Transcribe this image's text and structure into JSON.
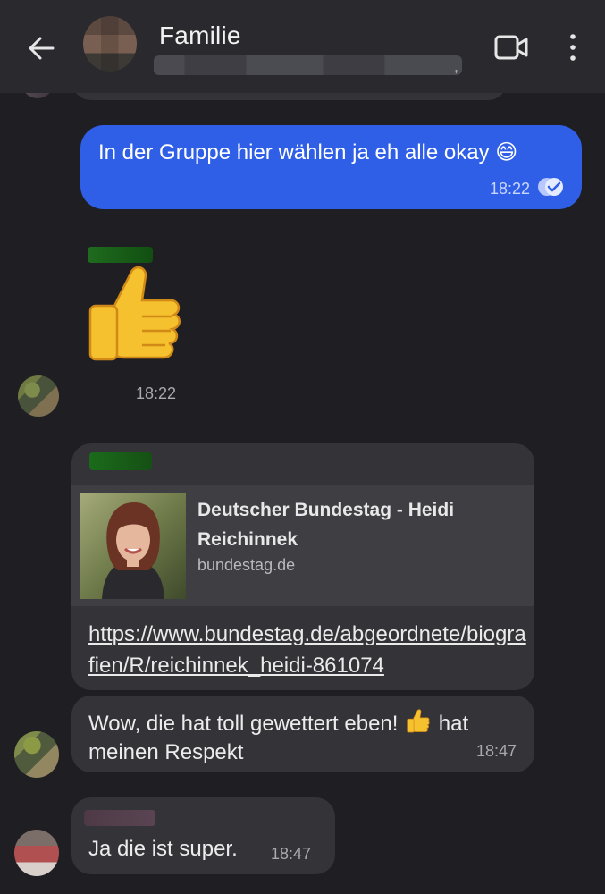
{
  "header": {
    "title": "Familie",
    "members_trailing": ",",
    "icons": {
      "back": "arrow-left-icon",
      "video": "video-call-icon",
      "more": "more-vert-icon"
    }
  },
  "messages": {
    "outgoing": {
      "text": "In der Gruppe hier wählen ja eh alle okay",
      "emoji": "😄",
      "time": "18:22",
      "status": "read"
    },
    "thumb_message": {
      "emoji": "thumbs-up",
      "time": "18:22"
    },
    "link_message": {
      "preview_title": "Deutscher Bundestag - Heidi Reichinnek",
      "preview_domain": "bundestag.de",
      "url": "https://www.bundestag.de/abgeordnete/biografien/R/reichinnek_heidi-861074"
    },
    "reply1": {
      "text_before": "Wow, die hat toll gewettert eben!",
      "text_after": "hat meinen Respekt",
      "time": "18:47"
    },
    "reply2": {
      "text": "Ja die ist super.",
      "time": "18:47"
    }
  },
  "colors": {
    "outgoing_bubble": "#2f5fe7",
    "incoming_bubble": "#333338",
    "background": "#1f1f23",
    "header": "#29292e"
  }
}
